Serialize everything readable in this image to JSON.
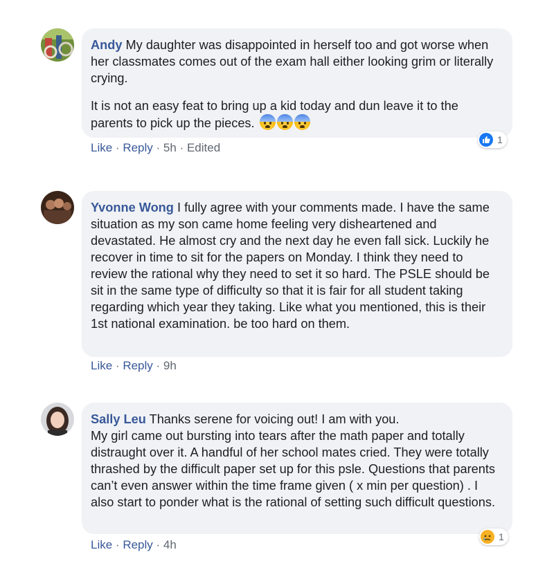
{
  "comments": [
    {
      "author": "Andy",
      "paragraphs": [
        " My daughter was disappointed in herself too and got worse when her classmates comes out of the exam hall either looking grim or literally crying.",
        "It is not an easy feat to bring up a kid today and dun leave it to the parents to pick up the pieces."
      ],
      "emojis": [
        "anxious-face-icon",
        "anxious-face-icon",
        "anxious-face-icon"
      ],
      "actions": {
        "like": "Like",
        "reply": "Reply",
        "time": "5h",
        "edited": "Edited"
      },
      "reaction": {
        "icon": "like-reaction-icon",
        "count": "1",
        "color": "#1877f2"
      }
    },
    {
      "author": "Yvonne Wong",
      "paragraphs": [
        " I fully agree with your comments made. I have the same situation as my son came home feeling very disheartened and devastated. He almost cry and the next day he even fall sick. Luckily he recover in time to sit for the papers on Monday. I think they need to review the rational why they need to set it so hard. The PSLE should be sit in the same type of difficulty so that it is fair for all student taking regarding which year they taking. Like what you mentioned, this is their 1st national examination. be too hard on them."
      ],
      "actions": {
        "like": "Like",
        "reply": "Reply",
        "time": "9h"
      }
    },
    {
      "author": "Sally Leu",
      "paragraphs": [
        " Thanks serene for voicing out! I am with you.",
        "My girl came out bursting into tears after the math paper and totally distraught over it. A handful of her school mates cried. They were totally thrashed by the difficult paper set up for this psle. Questions that parents can’t even answer within the time frame given ( x min per question) . I also start to ponder what is the rational of setting such difficult questions."
      ],
      "actions": {
        "like": "Like",
        "reply": "Reply",
        "time": "4h"
      },
      "reaction": {
        "icon": "sad-reaction-icon",
        "count": "1",
        "color": "#f7b125"
      }
    }
  ]
}
